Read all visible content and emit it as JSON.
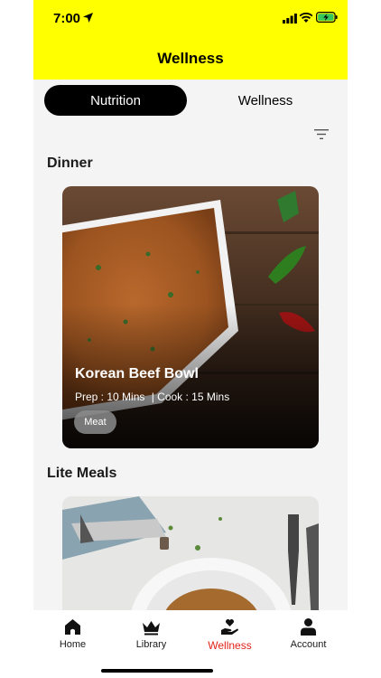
{
  "status_bar": {
    "time": "7:00"
  },
  "header": {
    "title": "Wellness"
  },
  "segments": {
    "active": "Nutrition",
    "inactive": "Wellness"
  },
  "sections": [
    {
      "title": "Dinner",
      "card": {
        "title": "Korean Beef Bowl",
        "prep": "Prep : 10 Mins",
        "cook": "| Cook :  15 Mins",
        "tag": "Meat"
      }
    },
    {
      "title": "Lite Meals"
    }
  ],
  "tabbar": {
    "items": [
      {
        "label": "Home",
        "icon": "home-icon"
      },
      {
        "label": "Library",
        "icon": "crown-icon"
      },
      {
        "label": "Wellness",
        "icon": "heart-hand-icon",
        "active": true
      },
      {
        "label": "Account",
        "icon": "person-icon"
      }
    ]
  },
  "colors": {
    "header_bg": "#ffff00",
    "active_tab": "#e2231a",
    "segment_active_bg": "#000000"
  }
}
